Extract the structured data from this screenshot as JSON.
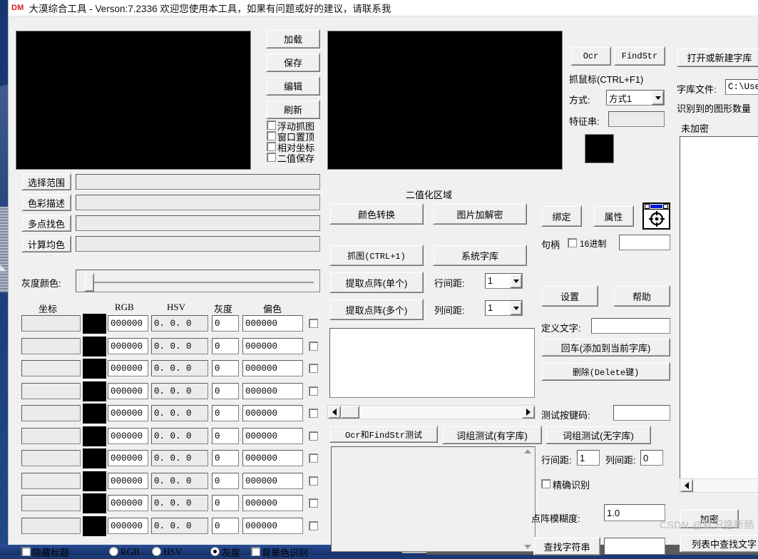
{
  "window": {
    "logo": "DM",
    "title": "大漠综合工具 -  Verson:7.2336  欢迎您使用本工具，如果有问题或好的建议，请联系我"
  },
  "left_panel": {
    "capture_buttons": [
      {
        "label": "加载",
        "name": "load-button"
      },
      {
        "label": "保存",
        "name": "save-button"
      },
      {
        "label": "编辑",
        "name": "edit-button"
      },
      {
        "label": "刷新",
        "name": "refresh-button"
      }
    ],
    "checkboxes": [
      {
        "label": "浮动抓图",
        "checked": false
      },
      {
        "label": "窗口置顶",
        "checked": false
      },
      {
        "label": "相对坐标",
        "checked": false
      },
      {
        "label": "二值保存",
        "checked": false
      }
    ],
    "field_rows": [
      {
        "button": "选择范围",
        "value": ""
      },
      {
        "button": "色彩描述",
        "value": ""
      },
      {
        "button": "多点找色",
        "value": ""
      },
      {
        "button": "计算均色",
        "value": ""
      }
    ],
    "gray_color_label": "灰度颜色:",
    "table": {
      "headers": [
        "坐标",
        "",
        "RGB",
        "HSV",
        "灰度",
        "偏色",
        ""
      ],
      "rows": [
        {
          "coord": "",
          "swatch": "#000000",
          "rgb": "000000",
          "hsv": "0. 0. 0",
          "gray": "0",
          "bias": "000000",
          "checked": false
        },
        {
          "coord": "",
          "swatch": "#000000",
          "rgb": "000000",
          "hsv": "0. 0. 0",
          "gray": "0",
          "bias": "000000",
          "checked": false
        },
        {
          "coord": "",
          "swatch": "#000000",
          "rgb": "000000",
          "hsv": "0. 0. 0",
          "gray": "0",
          "bias": "000000",
          "checked": false
        },
        {
          "coord": "",
          "swatch": "#000000",
          "rgb": "000000",
          "hsv": "0. 0. 0",
          "gray": "0",
          "bias": "000000",
          "checked": false
        },
        {
          "coord": "",
          "swatch": "#000000",
          "rgb": "000000",
          "hsv": "0. 0. 0",
          "gray": "0",
          "bias": "000000",
          "checked": false
        },
        {
          "coord": "",
          "swatch": "#000000",
          "rgb": "000000",
          "hsv": "0. 0. 0",
          "gray": "0",
          "bias": "000000",
          "checked": false
        },
        {
          "coord": "",
          "swatch": "#000000",
          "rgb": "000000",
          "hsv": "0. 0. 0",
          "gray": "0",
          "bias": "000000",
          "checked": false
        },
        {
          "coord": "",
          "swatch": "#000000",
          "rgb": "000000",
          "hsv": "0. 0. 0",
          "gray": "0",
          "bias": "000000",
          "checked": false
        },
        {
          "coord": "",
          "swatch": "#000000",
          "rgb": "000000",
          "hsv": "0. 0. 0",
          "gray": "0",
          "bias": "000000",
          "checked": false
        },
        {
          "coord": "",
          "swatch": "#000000",
          "rgb": "000000",
          "hsv": "0. 0. 0",
          "gray": "0",
          "bias": "000000",
          "checked": false
        }
      ]
    },
    "bottom_bar": {
      "hide_title": {
        "label": "隐藏标题",
        "checked": false
      },
      "radios": [
        {
          "label": "RGB",
          "selected": false
        },
        {
          "label": "HSV",
          "selected": false
        },
        {
          "label": "灰度",
          "selected": true
        }
      ],
      "bg_recognize": {
        "label": "背景色识别",
        "checked": false
      }
    }
  },
  "center_panel": {
    "binarize_title": "二值化区域",
    "buttons": [
      {
        "label": "颜色转换",
        "name": "color-convert-button"
      },
      {
        "label": "图片加解密",
        "name": "image-encrypt-decrypt-button"
      },
      {
        "label": "抓图(CTRL+1)",
        "name": "capture-button"
      },
      {
        "label": "系统字库",
        "name": "system-font-library-button"
      },
      {
        "label": "提取点阵(单个)",
        "name": "extract-dot-single-button"
      },
      {
        "label": "提取点阵(多个)",
        "name": "extract-dot-multi-button"
      }
    ],
    "row_spacing_label": "行间距:",
    "row_spacing_value": "1",
    "col_spacing_label": "列间距:",
    "col_spacing_value": "1",
    "preview_text": "",
    "tabs": [
      {
        "label": "Ocr和FindStr测试",
        "active": true
      },
      {
        "label": "词组测试(有字库)",
        "active": false
      },
      {
        "label": "词组测试(无字库)",
        "active": false
      }
    ],
    "result_text": ""
  },
  "right_panel": {
    "ocr_button": "Ocr",
    "findstr_button": "FindStr",
    "grab_mouse_label": "抓鼠标(CTRL+F1)",
    "mode_label": "方式:",
    "mode_value": "方式1",
    "feature_label": "特征串:",
    "feature_value": "",
    "bind_button": "绑定",
    "property_button": "属性",
    "handle_label": "句柄",
    "hex_label": "16进制",
    "hex_checked": false,
    "handle_value": "",
    "settings_button": "设置",
    "help_button": "帮助",
    "define_text_label": "定义文字:",
    "define_text_value": "",
    "enter_add_button": "回车(添加到当前字库)",
    "delete_button": "删除(Delete键)",
    "test_keycode_label": "测试按键码:",
    "test_keycode_value": "",
    "line_spacing_label": "行间距:",
    "line_spacing_value": "1",
    "col_spacing_label": "列间距:",
    "col_spacing_value": "0",
    "exact_recognize": {
      "label": "精确识别",
      "checked": false
    },
    "dot_blur_label": "点阵模糊度:",
    "dot_blur_value": "1.0",
    "find_string_button": "查找字符串",
    "find_string_value": ""
  },
  "far_right_panel": {
    "open_new_lib_button": "打开或新建字库",
    "lib_file_label": "字库文件:",
    "lib_file_value": "C:\\User",
    "recognized_count_label": "识别到的图形数量",
    "encryption_status": "未加密",
    "list_text": "",
    "encrypt_button": "加密",
    "find_in_list_button": "列表中查找文字"
  },
  "watermark": "CSDN @默汨撸断肠",
  "colors": {
    "window_bg": "#f0f0f0",
    "desktop": "#1b3a73",
    "logo_red": "#d81a1a",
    "black": "#000000"
  }
}
